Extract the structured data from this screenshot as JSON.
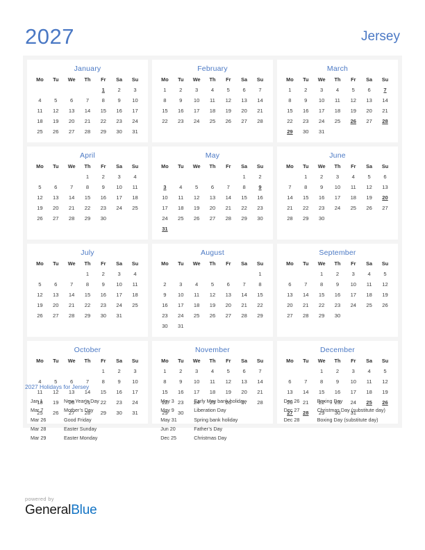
{
  "header": {
    "year": "2027",
    "country": "Jersey"
  },
  "weekdays": [
    "Mo",
    "Tu",
    "We",
    "Th",
    "Fr",
    "Sa",
    "Su"
  ],
  "months": [
    {
      "name": "January",
      "lead_blanks": 4,
      "days": 31,
      "holidays": [
        1
      ]
    },
    {
      "name": "February",
      "lead_blanks": 0,
      "days": 28,
      "holidays": []
    },
    {
      "name": "March",
      "lead_blanks": 0,
      "days": 31,
      "holidays": [
        7,
        26,
        28,
        29
      ]
    },
    {
      "name": "April",
      "lead_blanks": 3,
      "days": 30,
      "holidays": []
    },
    {
      "name": "May",
      "lead_blanks": 5,
      "days": 31,
      "holidays": [
        3,
        9,
        31
      ]
    },
    {
      "name": "June",
      "lead_blanks": 1,
      "days": 30,
      "holidays": [
        20
      ]
    },
    {
      "name": "July",
      "lead_blanks": 3,
      "days": 31,
      "holidays": []
    },
    {
      "name": "August",
      "lead_blanks": 6,
      "days": 31,
      "holidays": []
    },
    {
      "name": "September",
      "lead_blanks": 2,
      "days": 30,
      "holidays": []
    },
    {
      "name": "October",
      "lead_blanks": 4,
      "days": 31,
      "holidays": []
    },
    {
      "name": "November",
      "lead_blanks": 0,
      "days": 30,
      "holidays": []
    },
    {
      "name": "December",
      "lead_blanks": 2,
      "days": 31,
      "holidays": [
        25,
        26,
        27,
        28
      ]
    }
  ],
  "holidays_section": {
    "title": "2027 Holidays for Jersey",
    "columns": [
      [
        {
          "date": "Jan 1",
          "name": "New Year’s Day"
        },
        {
          "date": "Mar 7",
          "name": "Mother’s Day"
        },
        {
          "date": "Mar 26",
          "name": "Good Friday"
        },
        {
          "date": "Mar 28",
          "name": "Easter Sunday"
        },
        {
          "date": "Mar 29",
          "name": "Easter Monday"
        }
      ],
      [
        {
          "date": "May 3",
          "name": "Early May bank holiday"
        },
        {
          "date": "May 9",
          "name": "Liberation Day"
        },
        {
          "date": "May 31",
          "name": "Spring bank holiday"
        },
        {
          "date": "Jun 20",
          "name": "Father’s Day"
        },
        {
          "date": "Dec 25",
          "name": "Christmas Day"
        }
      ],
      [
        {
          "date": "Dec 26",
          "name": "Boxing Day"
        },
        {
          "date": "Dec 27",
          "name": "Christmas Day (substitute day)"
        },
        {
          "date": "Dec 28",
          "name": "Boxing Day (substitute day)"
        }
      ]
    ]
  },
  "footer": {
    "powered_by": "powered by",
    "logo_part1": "General",
    "logo_part2": "Blue"
  },
  "colors": {
    "accent_blue": "#4a78c4",
    "holiday_red": "#e01b1b",
    "logo_blue": "#1273c4",
    "panel_bg": "#f4f4f4"
  }
}
